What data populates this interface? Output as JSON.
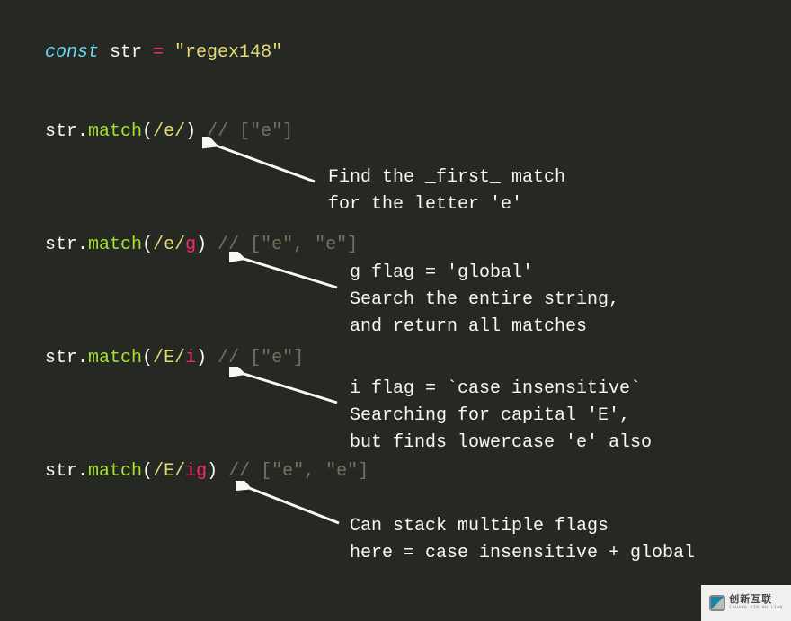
{
  "code": {
    "decl": {
      "keyword": "const",
      "ident": " str ",
      "op": "=",
      "string": " \"regex148\""
    },
    "lines": [
      {
        "obj": "str",
        "dot": ".",
        "method": "match",
        "lparen": "(",
        "regex": "/e/",
        "flags": "",
        "rparen": ")",
        "comment": " // [\"e\"]"
      },
      {
        "obj": "str",
        "dot": ".",
        "method": "match",
        "lparen": "(",
        "regex": "/e/",
        "flags": "g",
        "rparen": ")",
        "comment": " // [\"e\", \"e\"]"
      },
      {
        "obj": "str",
        "dot": ".",
        "method": "match",
        "lparen": "(",
        "regex": "/E/",
        "flags": "i",
        "rparen": ")",
        "comment": " // [\"e\"]"
      },
      {
        "obj": "str",
        "dot": ".",
        "method": "match",
        "lparen": "(",
        "regex": "/E/",
        "flags": "ig",
        "rparen": ")",
        "comment": " // [\"e\", \"e\"]"
      }
    ]
  },
  "annotations": [
    "Find the _first_ match\nfor the letter 'e'",
    "g flag = 'global'\nSearch the entire string,\nand return all matches",
    "i flag = `case insensitive`\nSearching for capital 'E',\nbut finds lowercase 'e' also",
    "Can stack multiple flags\nhere = case insensitive + global"
  ],
  "watermark": {
    "main": "创新互联",
    "sub": "CHUANG XIN HU LIAN"
  }
}
